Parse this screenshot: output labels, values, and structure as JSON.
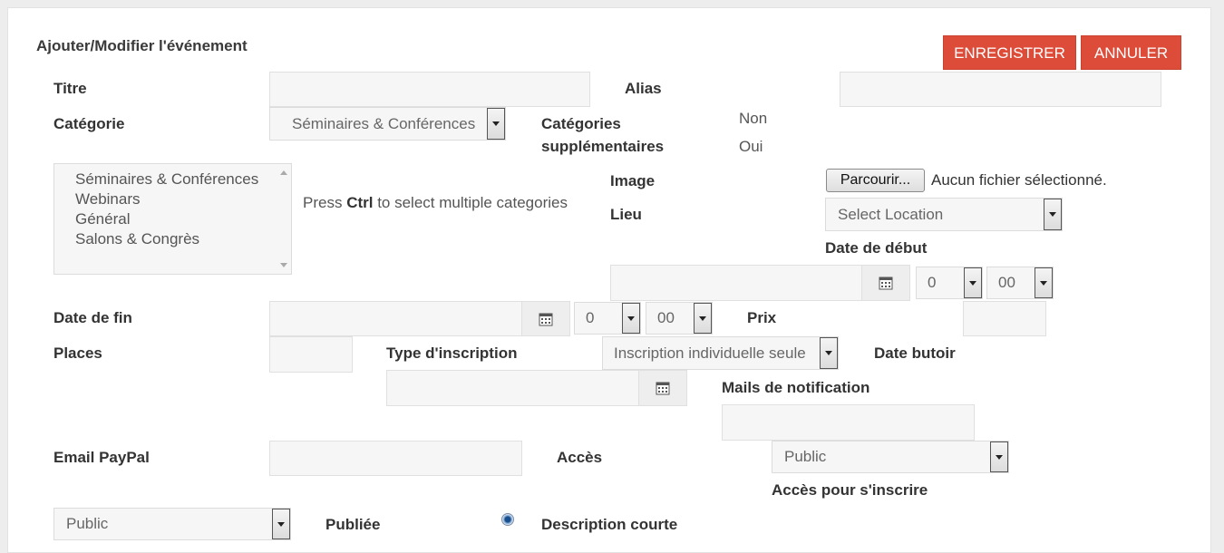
{
  "page_title": "Ajouter/Modifier l'événement",
  "toolbar": {
    "save_label": "ENREGISTRER",
    "cancel_label": "ANNULER"
  },
  "fields": {
    "titre": {
      "label": "Titre",
      "value": ""
    },
    "alias": {
      "label": "Alias",
      "value": ""
    },
    "categorie": {
      "label": "Catégorie",
      "selected": "Séminaires & Conférences"
    },
    "categories_supp": {
      "label_line1": "Catégories",
      "label_line2": "supplémentaires",
      "option_no": "Non",
      "option_yes": "Oui"
    },
    "category_list": {
      "items": [
        "Séminaires & Conférences",
        "Webinars",
        "Général",
        "Salons & Congrès"
      ]
    },
    "hint": {
      "prefix": "Press ",
      "key": "Ctrl",
      "suffix": " to select multiple categories"
    },
    "image": {
      "label": "Image",
      "button": "Parcourir...",
      "status": "Aucun fichier sélectionné."
    },
    "lieu": {
      "label": "Lieu",
      "selected": "Select Location"
    },
    "date_debut": {
      "label": "Date de début",
      "value": "",
      "hour": "0",
      "minute": "00"
    },
    "date_fin": {
      "label": "Date de fin",
      "value": "",
      "hour": "0",
      "minute": "00"
    },
    "prix": {
      "label": "Prix",
      "value": ""
    },
    "places": {
      "label": "Places",
      "value": ""
    },
    "type_inscription": {
      "label": "Type d'inscription",
      "selected": "Inscription individuelle seule"
    },
    "date_butoir": {
      "label": "Date butoir",
      "value": ""
    },
    "mails_notification": {
      "label": "Mails de notification",
      "value": ""
    },
    "email_paypal": {
      "label": "Email PayPal",
      "value": ""
    },
    "acces": {
      "label": "Accès",
      "selected": "Public"
    },
    "acces_inscrire": {
      "label": "Accès pour s'inscrire",
      "selected": "Public"
    },
    "publiee": {
      "label": "Publiée"
    },
    "description_courte": {
      "label": "Description courte"
    }
  },
  "colors": {
    "accent": "#dd4b39",
    "input_bg": "#f6f6f6",
    "page_bg": "#ededed"
  },
  "icons": {
    "calendar": "calendar-icon",
    "dropdown": "chevron-down-icon",
    "radio": "radio-selected-icon"
  }
}
